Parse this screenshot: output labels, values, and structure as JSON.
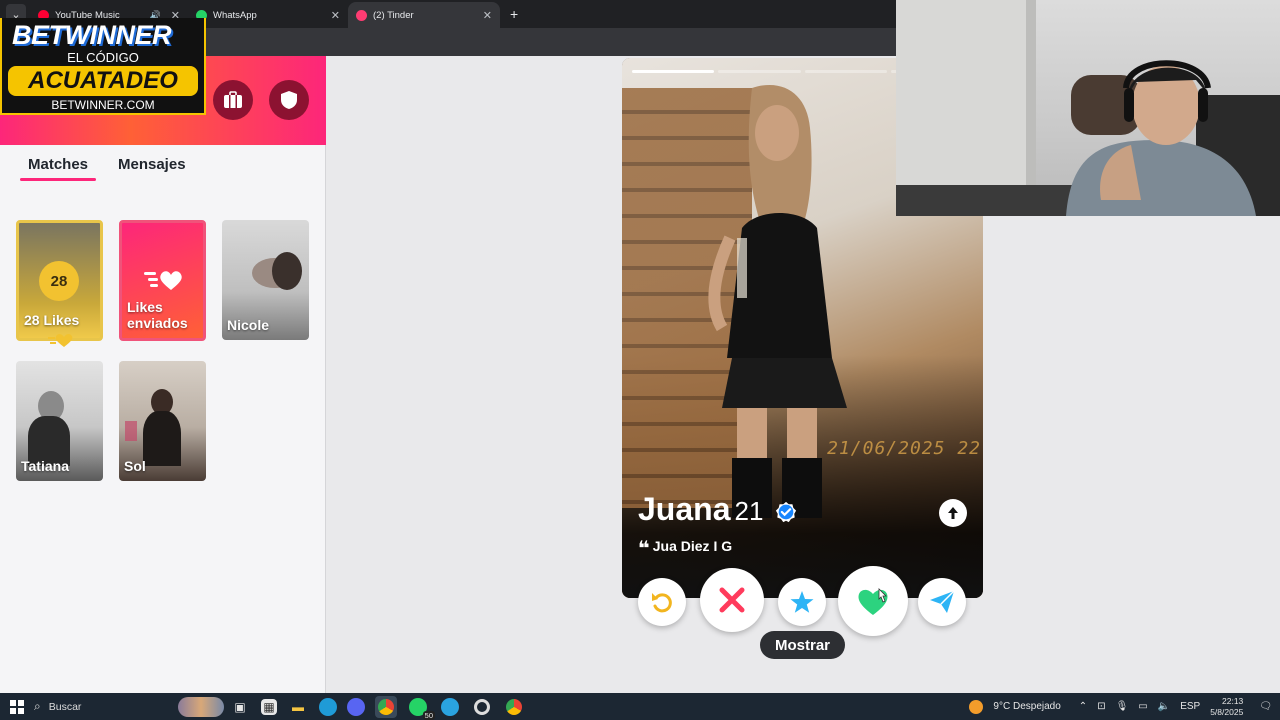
{
  "browser": {
    "tabs": [
      {
        "title": "YouTube Music",
        "favicon": "youtube-music-icon",
        "color": "#ff0033",
        "audio": true
      },
      {
        "title": "WhatsApp",
        "favicon": "whatsapp-icon",
        "color": "#25d366"
      },
      {
        "title": "(2) Tinder",
        "favicon": "tinder-icon",
        "color": "#fe3c72",
        "active": true
      }
    ],
    "new_tab": "+"
  },
  "sidebar": {
    "tabs": [
      {
        "label": "Matches",
        "active": true
      },
      {
        "label": "Mensajes"
      }
    ],
    "header_icons": [
      "briefcase-icon",
      "shield-icon"
    ],
    "cards": [
      {
        "label": "28 Likes",
        "count": "28",
        "type": "likes"
      },
      {
        "label": "Likes enviados",
        "type": "sent-likes"
      },
      {
        "label": "Nicole",
        "type": "match"
      },
      {
        "label": "Tatiana",
        "type": "match"
      },
      {
        "label": "Sol",
        "type": "match"
      }
    ]
  },
  "profile": {
    "name": "Juana",
    "age": "21",
    "bio": "Jua Diez I G",
    "photo_stamp": "21/06/2025 22",
    "photo_count": 4,
    "photo_index": 0
  },
  "actions": {
    "rewind": "rewind-icon",
    "nope": "x-icon",
    "super_like": "star-icon",
    "like": "heart-icon",
    "boost": "send-icon"
  },
  "tooltip": "Mostrar",
  "promo": {
    "brand": "BETWINNER",
    "line": "EL CÓDIGO",
    "code": "ACUATADEO",
    "site": "BETWINNER.COM"
  },
  "taskbar": {
    "search_placeholder": "Buscar",
    "weather": "9°C  Despejado",
    "lang": "ESP",
    "time": "22:13",
    "date": "5/8/2025",
    "whatsapp_badge": "50"
  },
  "colors": {
    "tinder_pink": "#fd267a",
    "tinder_orange": "#ff6036",
    "gold": "#f5c400",
    "like_green": "#2cd37f",
    "nope_red": "#ff3b5c",
    "star_blue": "#2db4f5"
  }
}
